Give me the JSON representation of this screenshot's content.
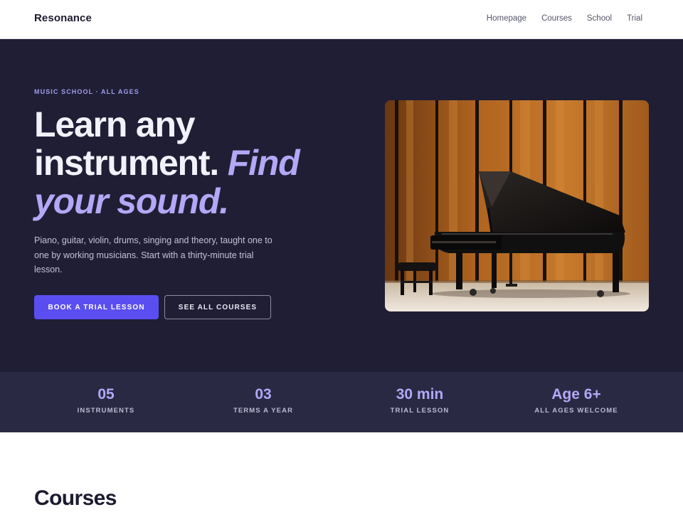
{
  "nav": {
    "brand": "Resonance",
    "links": [
      "Homepage",
      "Courses",
      "School",
      "Trial"
    ]
  },
  "hero": {
    "eyebrow": "MUSIC SCHOOL · ALL AGES",
    "headline_line1": "Learn any",
    "headline_line2_plain": "instrument. ",
    "headline_line2_accent": "Find",
    "headline_line3_accent": "your sound.",
    "lede": "Piano, guitar, violin, drums, singing and theory, taught one to one by working musicians. Start with a thirty-minute trial lesson.",
    "primary_button": "BOOK A TRIAL LESSON",
    "secondary_button": "SEE ALL COURSES",
    "image_subject": "grand-piano-on-stage"
  },
  "stats": [
    {
      "value": "05",
      "label": "INSTRUMENTS"
    },
    {
      "value": "03",
      "label": "TERMS A YEAR"
    },
    {
      "value": "30 min",
      "label": "TRIAL LESSON"
    },
    {
      "value": "Age 6+",
      "label": "ALL AGES WELCOME"
    }
  ],
  "courses": {
    "title": "Courses"
  },
  "colors": {
    "hero_background": "#1f1e34",
    "stats_background": "#2a2944",
    "accent": "#b3a8f6",
    "primary_button": "#5b4ef0"
  }
}
